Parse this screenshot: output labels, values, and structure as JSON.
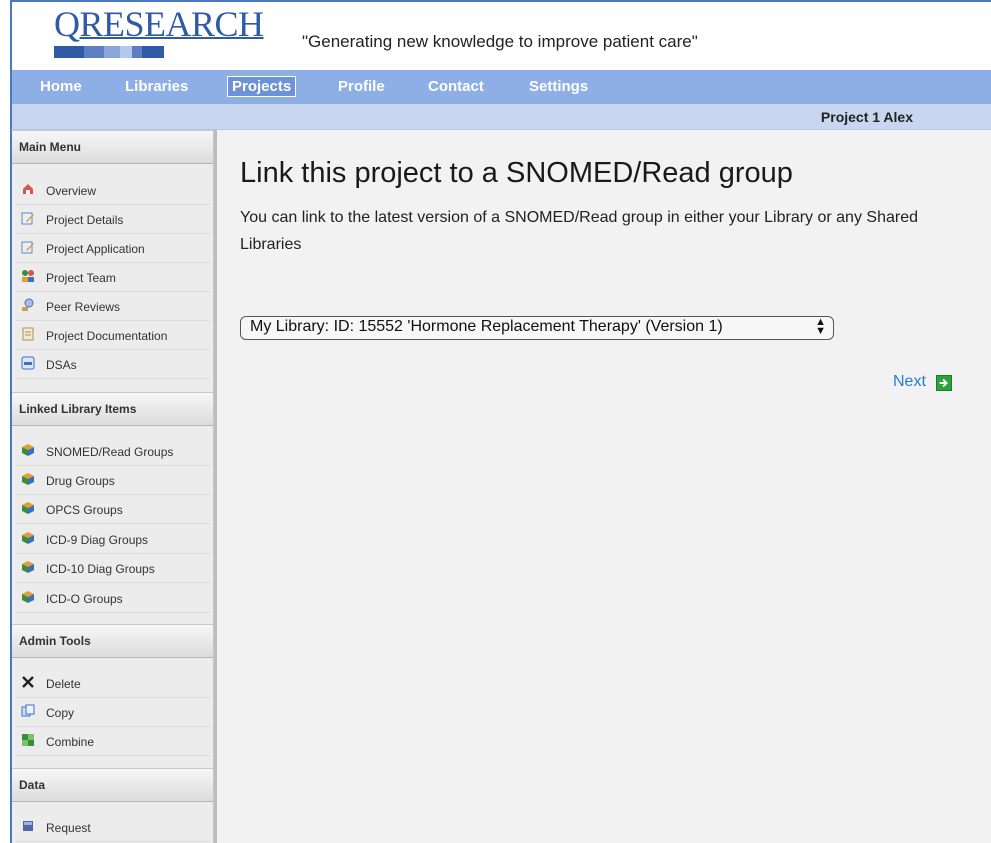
{
  "brand": {
    "name": "RESEARCH",
    "initial": "Q",
    "tagline": "\"Generating new knowledge to improve patient care\""
  },
  "nav": {
    "items": [
      {
        "label": "Home"
      },
      {
        "label": "Libraries"
      },
      {
        "label": "Projects",
        "active": true
      },
      {
        "label": "Profile"
      },
      {
        "label": "Contact"
      },
      {
        "label": "Settings"
      }
    ]
  },
  "project_label": "Project 1 Alex",
  "sidebar": {
    "main_menu": {
      "title": "Main Menu",
      "items": [
        {
          "label": "Overview",
          "icon": "overview-icon"
        },
        {
          "label": "Project Details",
          "icon": "edit-icon"
        },
        {
          "label": "Project Application",
          "icon": "edit-icon"
        },
        {
          "label": "Project Team",
          "icon": "team-icon"
        },
        {
          "label": "Peer Reviews",
          "icon": "review-icon"
        },
        {
          "label": "Project Documentation",
          "icon": "document-icon"
        },
        {
          "label": "DSAs",
          "icon": "dsa-icon"
        }
      ]
    },
    "linked": {
      "title": "Linked Library Items",
      "items": [
        {
          "label": "SNOMED/Read Groups",
          "icon": "group-icon"
        },
        {
          "label": "Drug Groups",
          "icon": "group-icon"
        },
        {
          "label": "OPCS Groups",
          "icon": "group-icon"
        },
        {
          "label": "ICD-9 Diag Groups",
          "icon": "group-icon"
        },
        {
          "label": "ICD-10 Diag Groups",
          "icon": "group-icon"
        },
        {
          "label": "ICD-O Groups",
          "icon": "group-icon"
        }
      ]
    },
    "admin": {
      "title": "Admin Tools",
      "items": [
        {
          "label": "Delete",
          "icon": "delete-icon"
        },
        {
          "label": "Copy",
          "icon": "copy-icon"
        },
        {
          "label": "Combine",
          "icon": "combine-icon"
        }
      ]
    },
    "data": {
      "title": "Data",
      "items": [
        {
          "label": "Request",
          "icon": "request-icon"
        }
      ]
    }
  },
  "main": {
    "title": "Link this project to a SNOMED/Read group",
    "description": "You can link to the latest version of a SNOMED/Read group in either your Library or any Shared Libraries",
    "select_value": "My Library: ID: 15552 'Hormone Replacement Therapy' (Version 1)",
    "next_label": "Next"
  },
  "colors": {
    "nav_bg": "#8eaee6",
    "brand_blue": "#2f5aa6",
    "link": "#1f7fd0",
    "next_icon": "#2da23c"
  }
}
